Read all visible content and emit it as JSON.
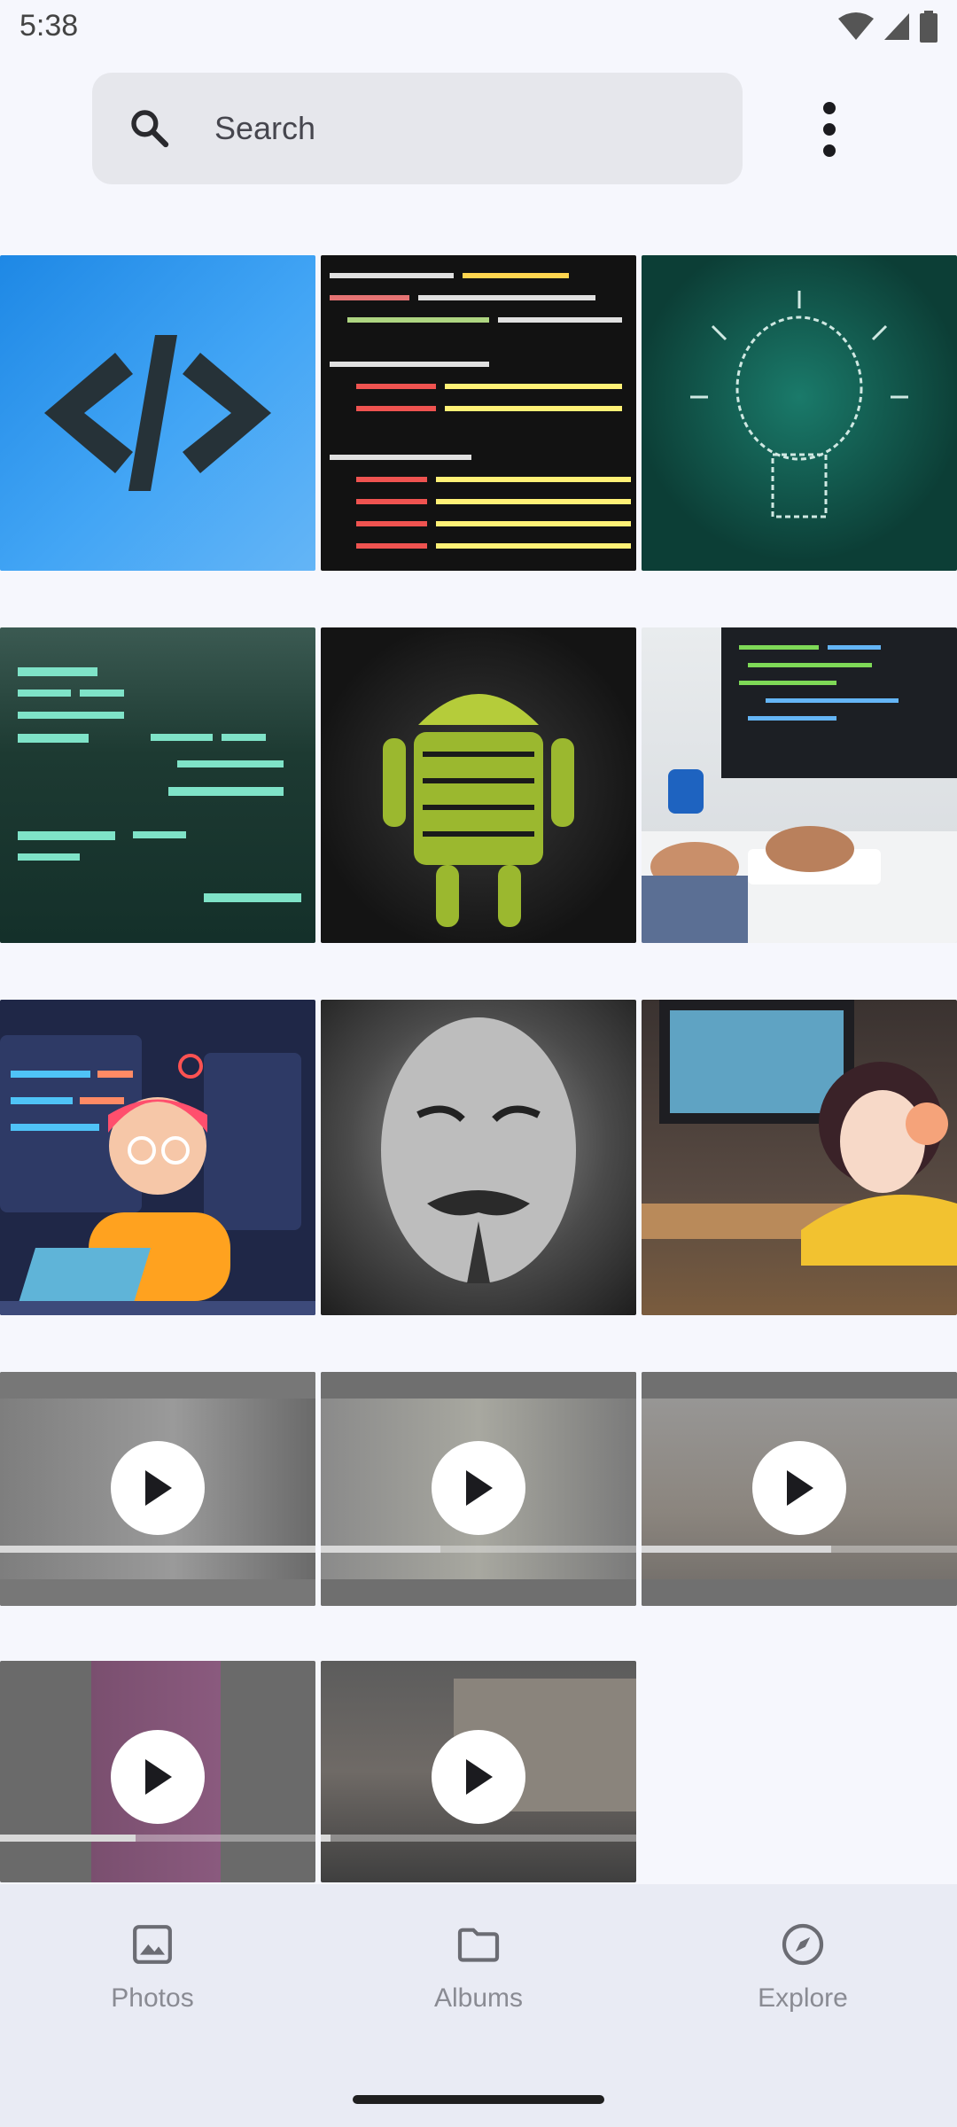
{
  "status_bar": {
    "time": "5:38"
  },
  "search": {
    "placeholder": "Search"
  },
  "photos": [
    {
      "name": "photo-code-icon",
      "colors": [
        "#1e88e5",
        "#42a5f5"
      ]
    },
    {
      "name": "photo-html-code",
      "colors": [
        "#111111",
        "#2b2b2b"
      ]
    },
    {
      "name": "photo-lightbulb-words",
      "colors": [
        "#0b3d36",
        "#14655a"
      ]
    },
    {
      "name": "photo-creative-words",
      "colors": [
        "#1d3a32",
        "#2f5a4a"
      ]
    },
    {
      "name": "photo-android-typography",
      "colors": [
        "#161616",
        "#3a3a3a"
      ]
    },
    {
      "name": "photo-typing-computer",
      "colors": [
        "#c9ccd0",
        "#eef0f2"
      ]
    },
    {
      "name": "photo-web-developer",
      "colors": [
        "#1f2747",
        "#2f3a6a"
      ]
    },
    {
      "name": "photo-mask-text",
      "colors": [
        "#2a2a2a",
        "#8a8a8a"
      ]
    },
    {
      "name": "photo-anime-headphones",
      "colors": [
        "#3c3331",
        "#8a6a4a"
      ]
    }
  ],
  "videos": [
    {
      "name": "video-writing",
      "progress": 1.0
    },
    {
      "name": "video-money",
      "progress": 0.38
    },
    {
      "name": "video-person-outdoors",
      "progress": 0.6
    },
    {
      "name": "video-pink-wall",
      "progress": 0.43
    },
    {
      "name": "video-warehouse",
      "progress": 0.03
    }
  ],
  "nav": {
    "photos_label": "Photos",
    "albums_label": "Albums",
    "explore_label": "Explore"
  }
}
